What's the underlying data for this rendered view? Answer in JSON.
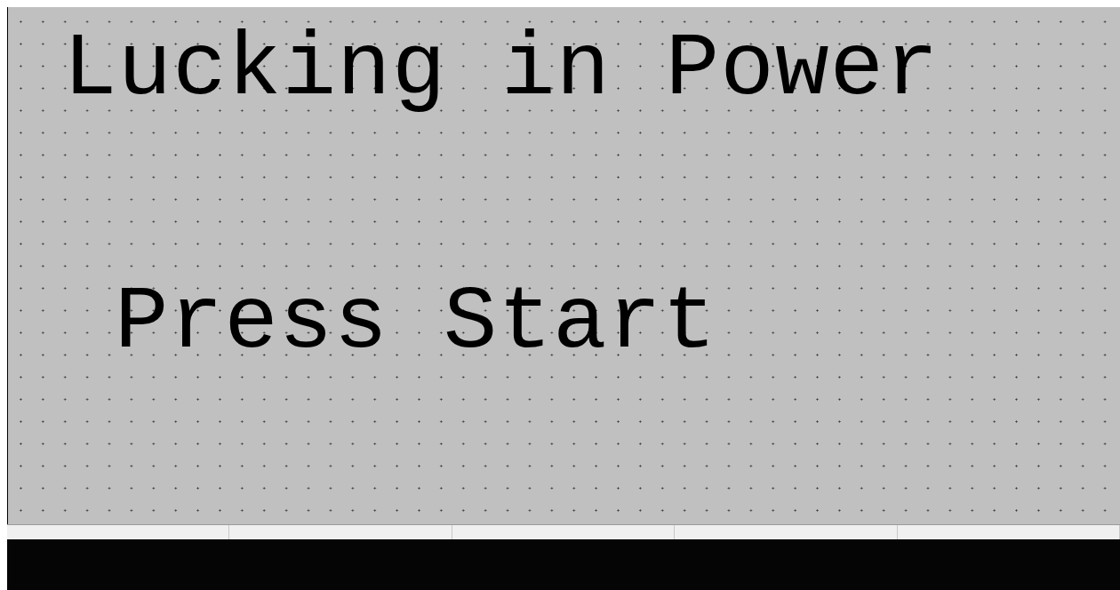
{
  "screen": {
    "lines": [
      {
        "text": "Lucking in Power"
      },
      {
        "text": "Press Start"
      }
    ]
  }
}
